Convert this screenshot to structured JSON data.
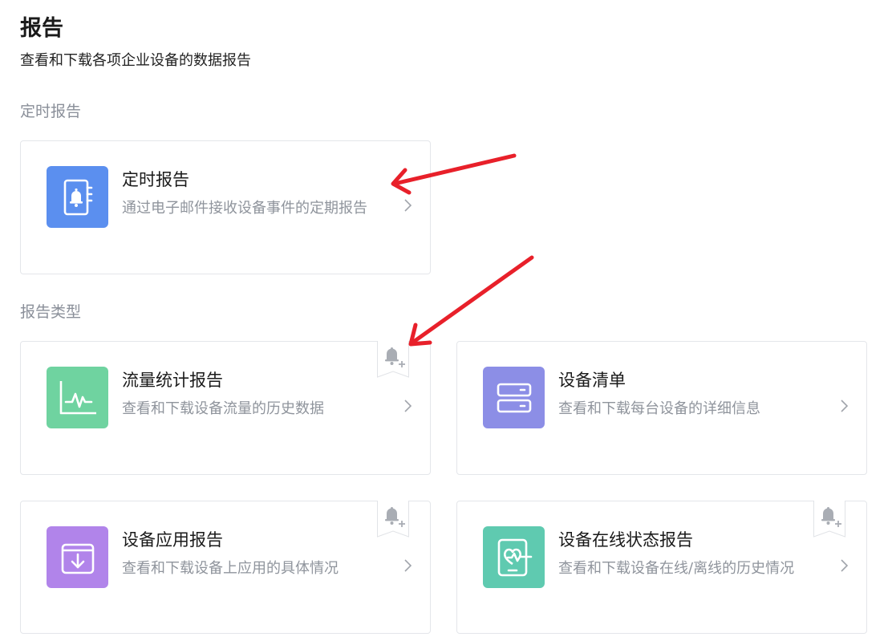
{
  "header": {
    "title": "报告",
    "subtitle": "查看和下载各项企业设备的数据报告"
  },
  "sections": {
    "scheduled": "定时报告",
    "types": "报告类型"
  },
  "cards": {
    "scheduled": {
      "title": "定时报告",
      "desc": "通过电子邮件接收设备事件的定期报告",
      "icon": "notebook-bell-icon",
      "color": "#5b8fef"
    },
    "traffic": {
      "title": "流量统计报告",
      "desc": "查看和下载设备流量的历史数据",
      "icon": "line-chart-icon",
      "color": "#6fd3a0"
    },
    "inventory": {
      "title": "设备清单",
      "desc": "查看和下载每台设备的详细信息",
      "icon": "server-list-icon",
      "color": "#8c8ee6"
    },
    "apps": {
      "title": "设备应用报告",
      "desc": "查看和下载设备上应用的具体情况",
      "icon": "download-box-icon",
      "color": "#b184ea"
    },
    "online": {
      "title": "设备在线状态报告",
      "desc": "查看和下载设备在线/离线的历史情况",
      "icon": "tablet-heartbeat-icon",
      "color": "#5fcab0"
    }
  },
  "colors": {
    "arrow": "#e8202a",
    "bookmark_bell": "#a9adb4",
    "border": "#e4e6ea"
  }
}
